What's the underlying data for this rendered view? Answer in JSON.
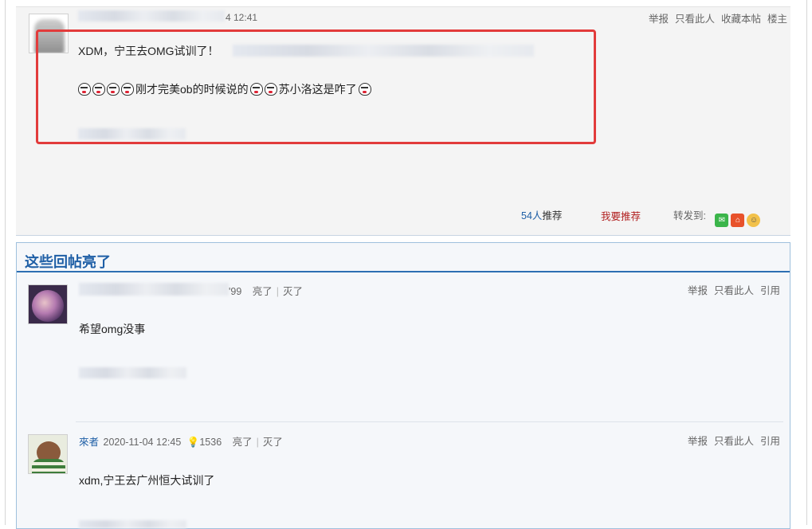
{
  "post": {
    "time": "4 12:41",
    "actions": [
      "举报",
      "只看此人",
      "收藏本帖",
      "楼主"
    ],
    "line1": "XDM，宁王去OMG试训了！",
    "line2": {
      "emoji_before": 4,
      "text1": "刚才完美ob的时候说的",
      "emoji_middle": 2,
      "text2": "苏小洛这是咋了",
      "emoji_after": 1
    },
    "recommend_count": "54人",
    "recommend_label": "推荐",
    "want_recommend": "我要推荐",
    "share_label": "转发到:",
    "share_icons": [
      "wechat-icon",
      "home-share-icon",
      "emoji-share-icon"
    ]
  },
  "lit_section": {
    "title": "这些回帖亮了",
    "replies": [
      {
        "user_suffix": "'99",
        "light_label": "亮了",
        "dim_label": "灭了",
        "actions": [
          "举报",
          "只看此人",
          "引用"
        ],
        "text": "希望omg没事"
      },
      {
        "user": "來者",
        "time": "2020-11-04 12:45",
        "light_count": "1536",
        "light_label": "亮了",
        "dim_label": "灭了",
        "actions": [
          "举报",
          "只看此人",
          "引用"
        ],
        "text": "xdm,宁王去广州恒大试训了"
      }
    ]
  },
  "colors": {
    "accent": "#1f5fa6",
    "highlight_box": "#e23b3b",
    "want_recommend": "#b22222"
  }
}
